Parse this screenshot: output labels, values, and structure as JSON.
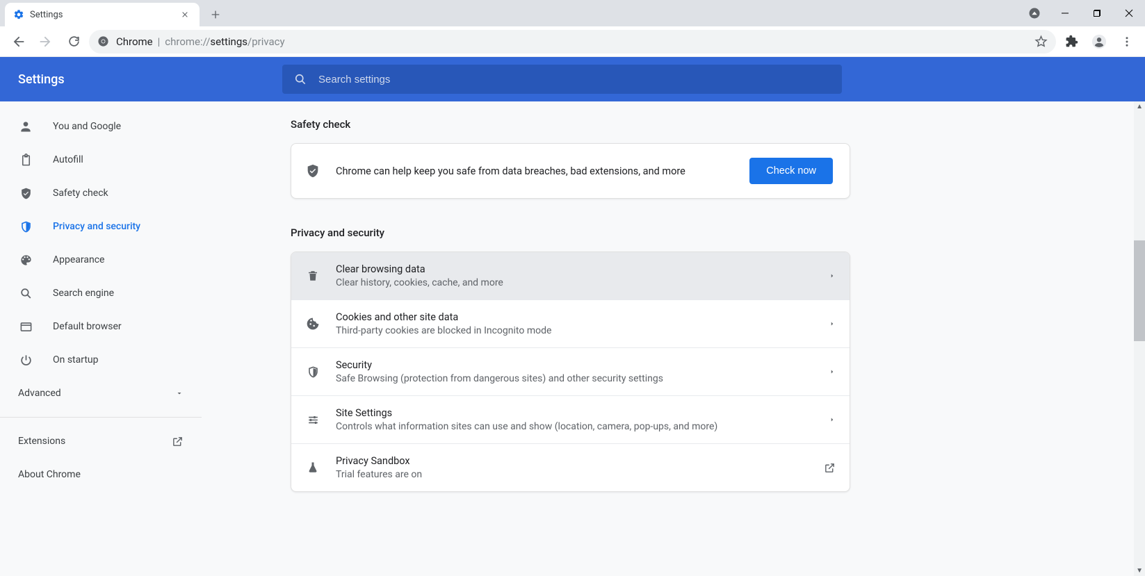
{
  "browser": {
    "tab_title": "Settings",
    "url_label": "Chrome",
    "url_prefix": "chrome://",
    "url_bold": "settings",
    "url_suffix": "/privacy"
  },
  "app": {
    "title": "Settings",
    "search_placeholder": "Search settings"
  },
  "sidebar": {
    "items": [
      {
        "label": "You and Google"
      },
      {
        "label": "Autofill"
      },
      {
        "label": "Safety check"
      },
      {
        "label": "Privacy and security"
      },
      {
        "label": "Appearance"
      },
      {
        "label": "Search engine"
      },
      {
        "label": "Default browser"
      },
      {
        "label": "On startup"
      }
    ],
    "advanced_label": "Advanced",
    "extensions_label": "Extensions",
    "about_label": "About Chrome"
  },
  "main": {
    "safety_section_title": "Safety check",
    "safety_text": "Chrome can help keep you safe from data breaches, bad extensions, and more",
    "check_now_label": "Check now",
    "privacy_section_title": "Privacy and security",
    "privacy_rows": [
      {
        "primary": "Clear browsing data",
        "secondary": "Clear history, cookies, cache, and more"
      },
      {
        "primary": "Cookies and other site data",
        "secondary": "Third-party cookies are blocked in Incognito mode"
      },
      {
        "primary": "Security",
        "secondary": "Safe Browsing (protection from dangerous sites) and other security settings"
      },
      {
        "primary": "Site Settings",
        "secondary": "Controls what information sites can use and show (location, camera, pop-ups, and more)"
      },
      {
        "primary": "Privacy Sandbox",
        "secondary": "Trial features are on"
      }
    ]
  },
  "colors": {
    "accent": "#1a73e8",
    "header": "#3367d6"
  }
}
